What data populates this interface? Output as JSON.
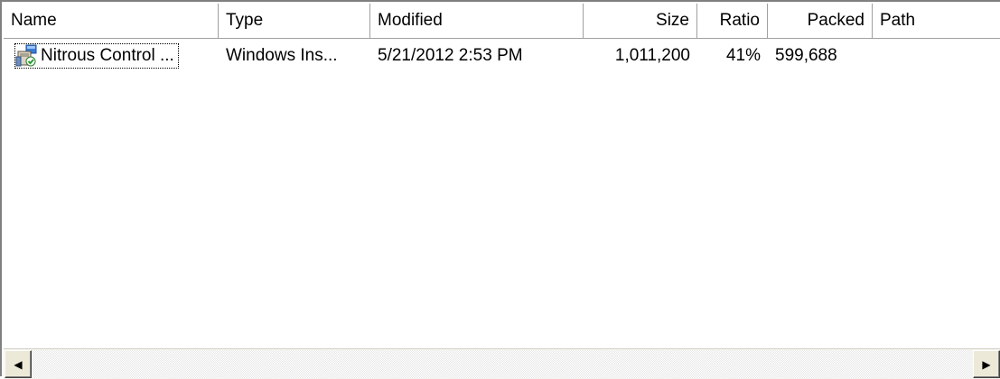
{
  "columns": {
    "name": "Name",
    "type": "Type",
    "modified": "Modified",
    "size": "Size",
    "ratio": "Ratio",
    "packed": "Packed",
    "path": "Path"
  },
  "rows": [
    {
      "name": "Nitrous Control ...",
      "type": "Windows Ins...",
      "modified": "5/21/2012 2:53 PM",
      "size": "1,011,200",
      "ratio": "41%",
      "packed": "599,688",
      "path": "",
      "icon": "installer-package-icon"
    }
  ],
  "scrollbar": {
    "left_arrow": "◀",
    "right_arrow": "▶"
  }
}
